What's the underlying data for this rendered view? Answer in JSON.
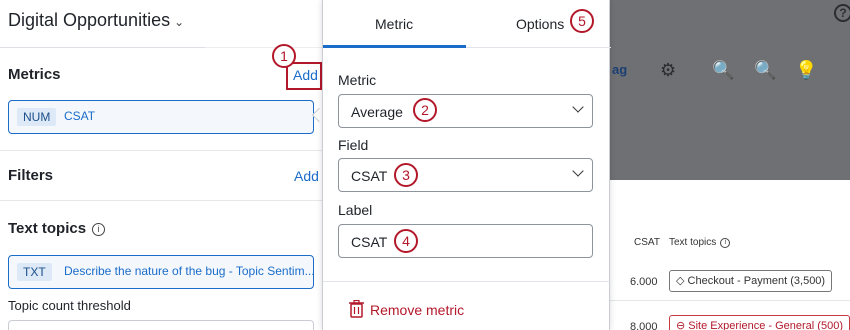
{
  "dashboard": {
    "title": "Digital Opportunities"
  },
  "sidebar": {
    "metrics": {
      "label": "Metrics",
      "add_label": "Add",
      "item": {
        "tag": "NUM",
        "name": "CSAT"
      }
    },
    "filters": {
      "label": "Filters",
      "add_label": "Add"
    },
    "text_topics": {
      "label": "Text topics",
      "item": {
        "tag": "TXT",
        "name": "Describe the nature of the bug - Topic Sentim..."
      }
    },
    "topic_count_threshold": {
      "label": "Topic count threshold"
    }
  },
  "panel": {
    "tabs": [
      {
        "label": "Metric"
      },
      {
        "label": "Options"
      }
    ],
    "metric": {
      "label": "Metric",
      "value": "Average"
    },
    "field": {
      "label": "Field",
      "value": "CSAT"
    },
    "label": {
      "label": "Label",
      "value": "CSAT"
    },
    "remove_label": "Remove metric"
  },
  "callouts": [
    "1",
    "2",
    "3",
    "4",
    "5"
  ],
  "toolbar": {
    "text": "ag",
    "help": "?"
  },
  "table": {
    "headers": [
      "CSAT",
      "Text topics"
    ],
    "rows": [
      {
        "csat": "6.000",
        "topic": "Checkout - Payment",
        "count": "(3,500)",
        "sentiment": "neutral"
      },
      {
        "csat": "8.000",
        "topic": "Site Experience - General",
        "count": "(500)",
        "sentiment": "negative"
      }
    ]
  },
  "colors": {
    "accent": "#1b6cc9",
    "callout": "#b3182a",
    "overlay": "#6f7073"
  }
}
